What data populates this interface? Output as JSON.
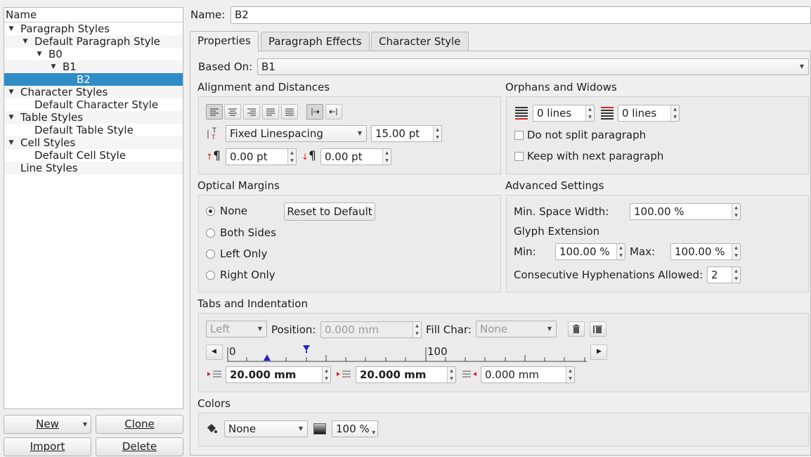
{
  "styles_tree": {
    "header": "Name",
    "items": [
      {
        "label": "Paragraph Styles",
        "expanded": true
      },
      {
        "label": "Default Paragraph Style",
        "expanded": true
      },
      {
        "label": "B0",
        "expanded": true
      },
      {
        "label": "B1",
        "expanded": true
      },
      {
        "label": "B2",
        "selected": true
      },
      {
        "label": "Character Styles",
        "expanded": true
      },
      {
        "label": "Default Character Style"
      },
      {
        "label": "Table Styles",
        "expanded": true
      },
      {
        "label": "Default Table Style"
      },
      {
        "label": "Cell Styles",
        "expanded": true
      },
      {
        "label": "Default Cell Style"
      },
      {
        "label": "Line Styles"
      }
    ]
  },
  "buttons": {
    "new_label": "New",
    "clone_label": "Clone",
    "import_label": "Import",
    "delete_label": "Delete"
  },
  "name_field": {
    "label": "Name:",
    "value": "B2"
  },
  "tabs": [
    {
      "label": "Properties",
      "active": true
    },
    {
      "label": "Paragraph Effects"
    },
    {
      "label": "Character Style"
    }
  ],
  "based_on": {
    "label": "Based On:",
    "value": "B1"
  },
  "alignment": {
    "title": "Alignment and Distances",
    "linespacing_mode": "Fixed Linespacing",
    "linespacing_value": "15.00 pt",
    "space_above": "0.00 pt",
    "space_below": "0.00 pt"
  },
  "orphans": {
    "title": "Orphans and Widows",
    "orphan_lines": "0 lines",
    "widow_lines": "0 lines",
    "no_split_label": "Do not split paragraph",
    "keep_next_label": "Keep with next paragraph"
  },
  "optical": {
    "title": "Optical Margins",
    "options": [
      "None",
      "Both Sides",
      "Left Only",
      "Right Only"
    ],
    "selected": "None",
    "reset_label": "Reset to Default"
  },
  "advanced": {
    "title": "Advanced Settings",
    "min_space_label": "Min. Space Width:",
    "min_space_value": "100.00 %",
    "glyph_title": "Glyph Extension",
    "min_label": "Min:",
    "min_value": "100.00 %",
    "max_label": "Max:",
    "max_value": "100.00 %",
    "hyphen_label": "Consecutive Hyphenations Allowed:",
    "hyphen_value": "2"
  },
  "tabs_indent": {
    "title": "Tabs and Indentation",
    "tab_type": "Left",
    "position_label": "Position:",
    "position_value": "0.000 mm",
    "fill_label": "Fill Char:",
    "fill_value": "None",
    "ruler_start": "0",
    "ruler_mark": "100",
    "first_indent": "20.000 mm",
    "left_indent": "20.000 mm",
    "right_indent": "0.000 mm"
  },
  "colors": {
    "title": "Colors",
    "fill_value": "None",
    "shade_value": "100 %"
  }
}
